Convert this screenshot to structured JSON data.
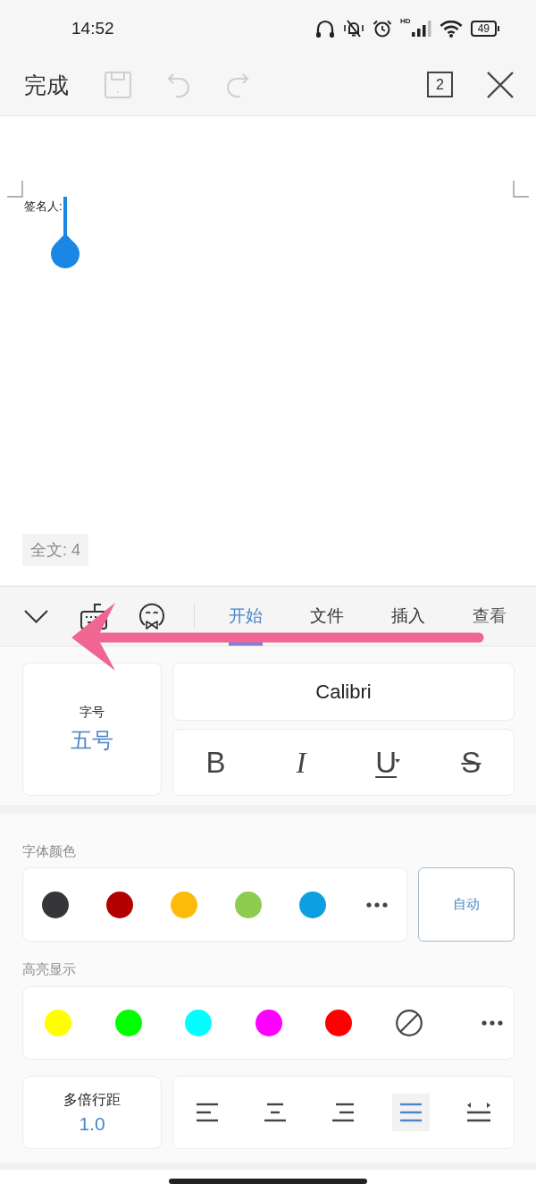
{
  "status_bar": {
    "time": "14:52",
    "network": "HD",
    "battery": "49"
  },
  "top_bar": {
    "done": "完成",
    "actions": [
      {
        "kind": "save",
        "disabled": true
      },
      {
        "kind": "undo",
        "disabled": true
      },
      {
        "kind": "redo",
        "disabled": true
      }
    ],
    "page_count": "2"
  },
  "document": {
    "text": "签名人:",
    "word_count": "全文: 4"
  },
  "ribbon": {
    "tabs": [
      {
        "label": "开始",
        "selected": true
      },
      {
        "label": "文件",
        "selected": false
      },
      {
        "label": "插入",
        "selected": false
      },
      {
        "label": "查看",
        "selected": false
      }
    ]
  },
  "font": {
    "size_label": "字号",
    "size_value": "五号",
    "name": "Calibri",
    "styles": [
      {
        "kind": "bold",
        "glyph": "B"
      },
      {
        "kind": "italic",
        "glyph": "I"
      },
      {
        "kind": "underline",
        "glyph": "U"
      },
      {
        "kind": "strikethrough",
        "glyph": "S"
      }
    ]
  },
  "font_color": {
    "label": "字体颜色",
    "colors": [
      {
        "color": "#36363a"
      },
      {
        "color": "#b30000"
      },
      {
        "color": "#fdbb0c"
      },
      {
        "color": "#8dcc4f"
      },
      {
        "color": "#0ca0e0"
      }
    ],
    "auto": "自动"
  },
  "highlight": {
    "label": "高亮显示",
    "colors": [
      {
        "color": "#ffff00"
      },
      {
        "color": "#00ff00"
      },
      {
        "color": "#00ffff"
      },
      {
        "color": "#ff00ff"
      },
      {
        "color": "#ff0000"
      }
    ]
  },
  "paragraph": {
    "spacing_label": "多倍行距",
    "spacing_value": "1.0",
    "alignments": [
      {
        "kind": "left",
        "selected": false
      },
      {
        "kind": "center",
        "selected": false
      },
      {
        "kind": "right",
        "selected": false
      },
      {
        "kind": "justify",
        "selected": true
      },
      {
        "kind": "distributed",
        "selected": false
      }
    ]
  }
}
